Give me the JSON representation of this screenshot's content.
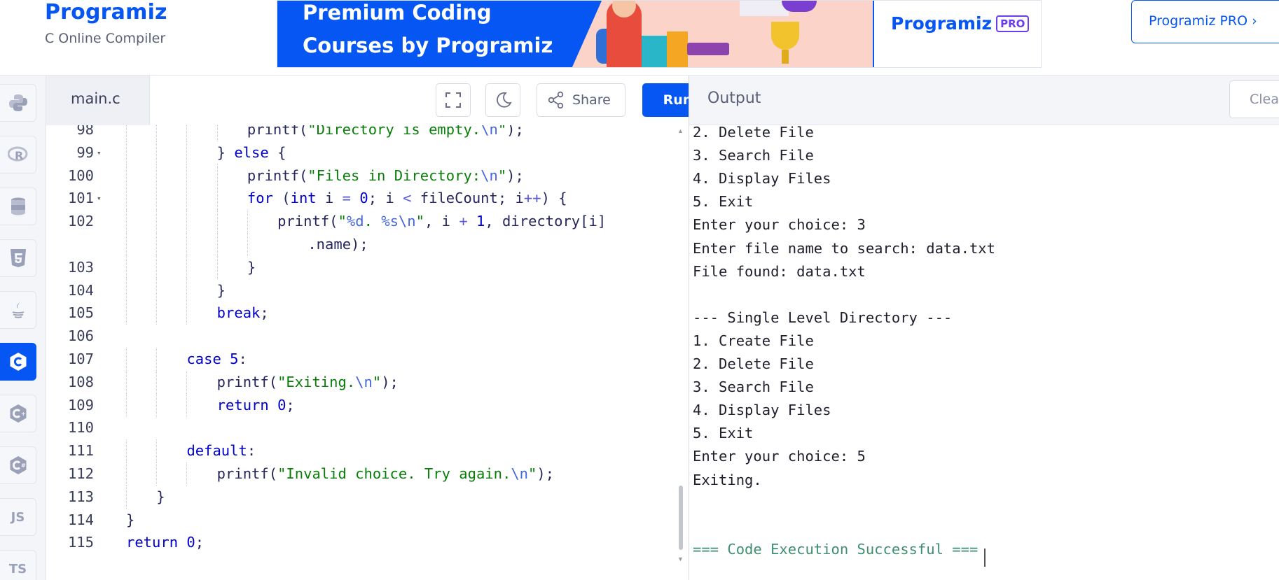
{
  "header": {
    "brand_name": "Programiz",
    "brand_subtitle": "C Online Compiler",
    "banner_line1": "Premium Coding",
    "banner_line2": "Courses by Programiz",
    "banner_pro_logo": "Programiz",
    "banner_pro_badge": "PRO",
    "pro_button_label": "Programiz PRO ›"
  },
  "sidebar": {
    "languages": [
      {
        "name": "python",
        "icon": "python-icon",
        "label": ""
      },
      {
        "name": "r",
        "icon": "r-icon",
        "label": ""
      },
      {
        "name": "sql",
        "icon": "database-icon",
        "label": ""
      },
      {
        "name": "html",
        "icon": "html5-icon",
        "label": ""
      },
      {
        "name": "java",
        "icon": "java-icon",
        "label": ""
      },
      {
        "name": "c",
        "icon": "c-icon",
        "label": "",
        "active": true
      },
      {
        "name": "cpp",
        "icon": "cpp-icon",
        "label": ""
      },
      {
        "name": "csharp",
        "icon": "csharp-icon",
        "label": ""
      },
      {
        "name": "javascript",
        "icon": "js-icon",
        "label": "JS"
      },
      {
        "name": "typescript",
        "icon": "ts-icon",
        "label": "TS"
      }
    ],
    "active_color": "#0556f3"
  },
  "editor": {
    "file_tab": "main.c",
    "share_label": "Share",
    "run_label": "Run",
    "lines": [
      {
        "n": "98",
        "fold": "",
        "indent": 4,
        "tokens": [
          [
            "f",
            "printf("
          ],
          [
            "s",
            "\"Directory is empty."
          ],
          [
            "e",
            "\\n"
          ],
          [
            "s",
            "\""
          ],
          [
            "p",
            ");"
          ]
        ]
      },
      {
        "n": "99",
        "fold": "▾",
        "indent": 3,
        "tokens": [
          [
            "p",
            "} "
          ],
          [
            "k",
            "else"
          ],
          [
            "p",
            " {"
          ]
        ]
      },
      {
        "n": "100",
        "fold": "",
        "indent": 4,
        "tokens": [
          [
            "f",
            "printf("
          ],
          [
            "s",
            "\"Files in Directory:"
          ],
          [
            "e",
            "\\n"
          ],
          [
            "s",
            "\""
          ],
          [
            "p",
            ");"
          ]
        ]
      },
      {
        "n": "101",
        "fold": "▾",
        "indent": 4,
        "tokens": [
          [
            "k",
            "for"
          ],
          [
            "p",
            " ("
          ],
          [
            "k",
            "int"
          ],
          [
            "p",
            " i "
          ],
          [
            "o",
            "="
          ],
          [
            "p",
            " "
          ],
          [
            "n",
            "0"
          ],
          [
            "p",
            "; i "
          ],
          [
            "o",
            "<"
          ],
          [
            "p",
            " fileCount; i"
          ],
          [
            "o",
            "++"
          ],
          [
            "p",
            ") {"
          ]
        ]
      },
      {
        "n": "102",
        "fold": "",
        "indent": 5,
        "tokens": [
          [
            "f",
            "printf("
          ],
          [
            "s",
            "\""
          ],
          [
            "e",
            "%d"
          ],
          [
            "s",
            ". "
          ],
          [
            "e",
            "%s\\n"
          ],
          [
            "s",
            "\""
          ],
          [
            "p",
            ", i "
          ],
          [
            "o",
            "+"
          ],
          [
            "p",
            " "
          ],
          [
            "n",
            "1"
          ],
          [
            "p",
            ", directory[i]"
          ]
        ]
      },
      {
        "n": "",
        "fold": "",
        "indent": 6,
        "tokens": [
          [
            "p",
            ".name);"
          ]
        ]
      },
      {
        "n": "103",
        "fold": "",
        "indent": 4,
        "tokens": [
          [
            "p",
            "}"
          ]
        ]
      },
      {
        "n": "104",
        "fold": "",
        "indent": 3,
        "tokens": [
          [
            "p",
            "}"
          ]
        ]
      },
      {
        "n": "105",
        "fold": "",
        "indent": 3,
        "tokens": [
          [
            "k",
            "break"
          ],
          [
            "p",
            ";"
          ]
        ]
      },
      {
        "n": "106",
        "fold": "",
        "indent": 0,
        "tokens": []
      },
      {
        "n": "107",
        "fold": "",
        "indent": 2,
        "tokens": [
          [
            "k",
            "case"
          ],
          [
            "p",
            " "
          ],
          [
            "n",
            "5"
          ],
          [
            "p",
            ":"
          ]
        ]
      },
      {
        "n": "108",
        "fold": "",
        "indent": 3,
        "tokens": [
          [
            "f",
            "printf("
          ],
          [
            "s",
            "\"Exiting."
          ],
          [
            "e",
            "\\n"
          ],
          [
            "s",
            "\""
          ],
          [
            "p",
            ");"
          ]
        ]
      },
      {
        "n": "109",
        "fold": "",
        "indent": 3,
        "tokens": [
          [
            "k",
            "return"
          ],
          [
            "p",
            " "
          ],
          [
            "n",
            "0"
          ],
          [
            "p",
            ";"
          ]
        ]
      },
      {
        "n": "110",
        "fold": "",
        "indent": 0,
        "tokens": []
      },
      {
        "n": "111",
        "fold": "",
        "indent": 2,
        "tokens": [
          [
            "k",
            "default"
          ],
          [
            "p",
            ":"
          ]
        ]
      },
      {
        "n": "112",
        "fold": "",
        "indent": 3,
        "tokens": [
          [
            "f",
            "printf("
          ],
          [
            "s",
            "\"Invalid choice. Try again."
          ],
          [
            "e",
            "\\n"
          ],
          [
            "s",
            "\""
          ],
          [
            "p",
            ");"
          ]
        ]
      },
      {
        "n": "113",
        "fold": "",
        "indent": 1,
        "tokens": [
          [
            "p",
            "}"
          ]
        ]
      },
      {
        "n": "114",
        "fold": "",
        "indent": 0,
        "tokens": [
          [
            "p",
            "}"
          ]
        ]
      },
      {
        "n": "115",
        "fold": "",
        "indent": 0,
        "tokens": [
          [
            "k",
            "return"
          ],
          [
            "p",
            " "
          ],
          [
            "n",
            "0"
          ],
          [
            "p",
            ";"
          ]
        ]
      }
    ]
  },
  "output": {
    "title": "Output",
    "clear_label": "Clear",
    "lines": [
      "2. Delete File",
      "3. Search File",
      "4. Display Files",
      "5. Exit",
      "Enter your choice: 3",
      "Enter file name to search: data.txt",
      "File found: data.txt",
      "",
      "--- Single Level Directory ---",
      "1. Create File",
      "2. Delete File",
      "3. Search File",
      "4. Display Files",
      "5. Exit",
      "Enter your choice: 5",
      "Exiting.",
      "",
      "",
      "=== Code Execution Successful ==="
    ]
  }
}
